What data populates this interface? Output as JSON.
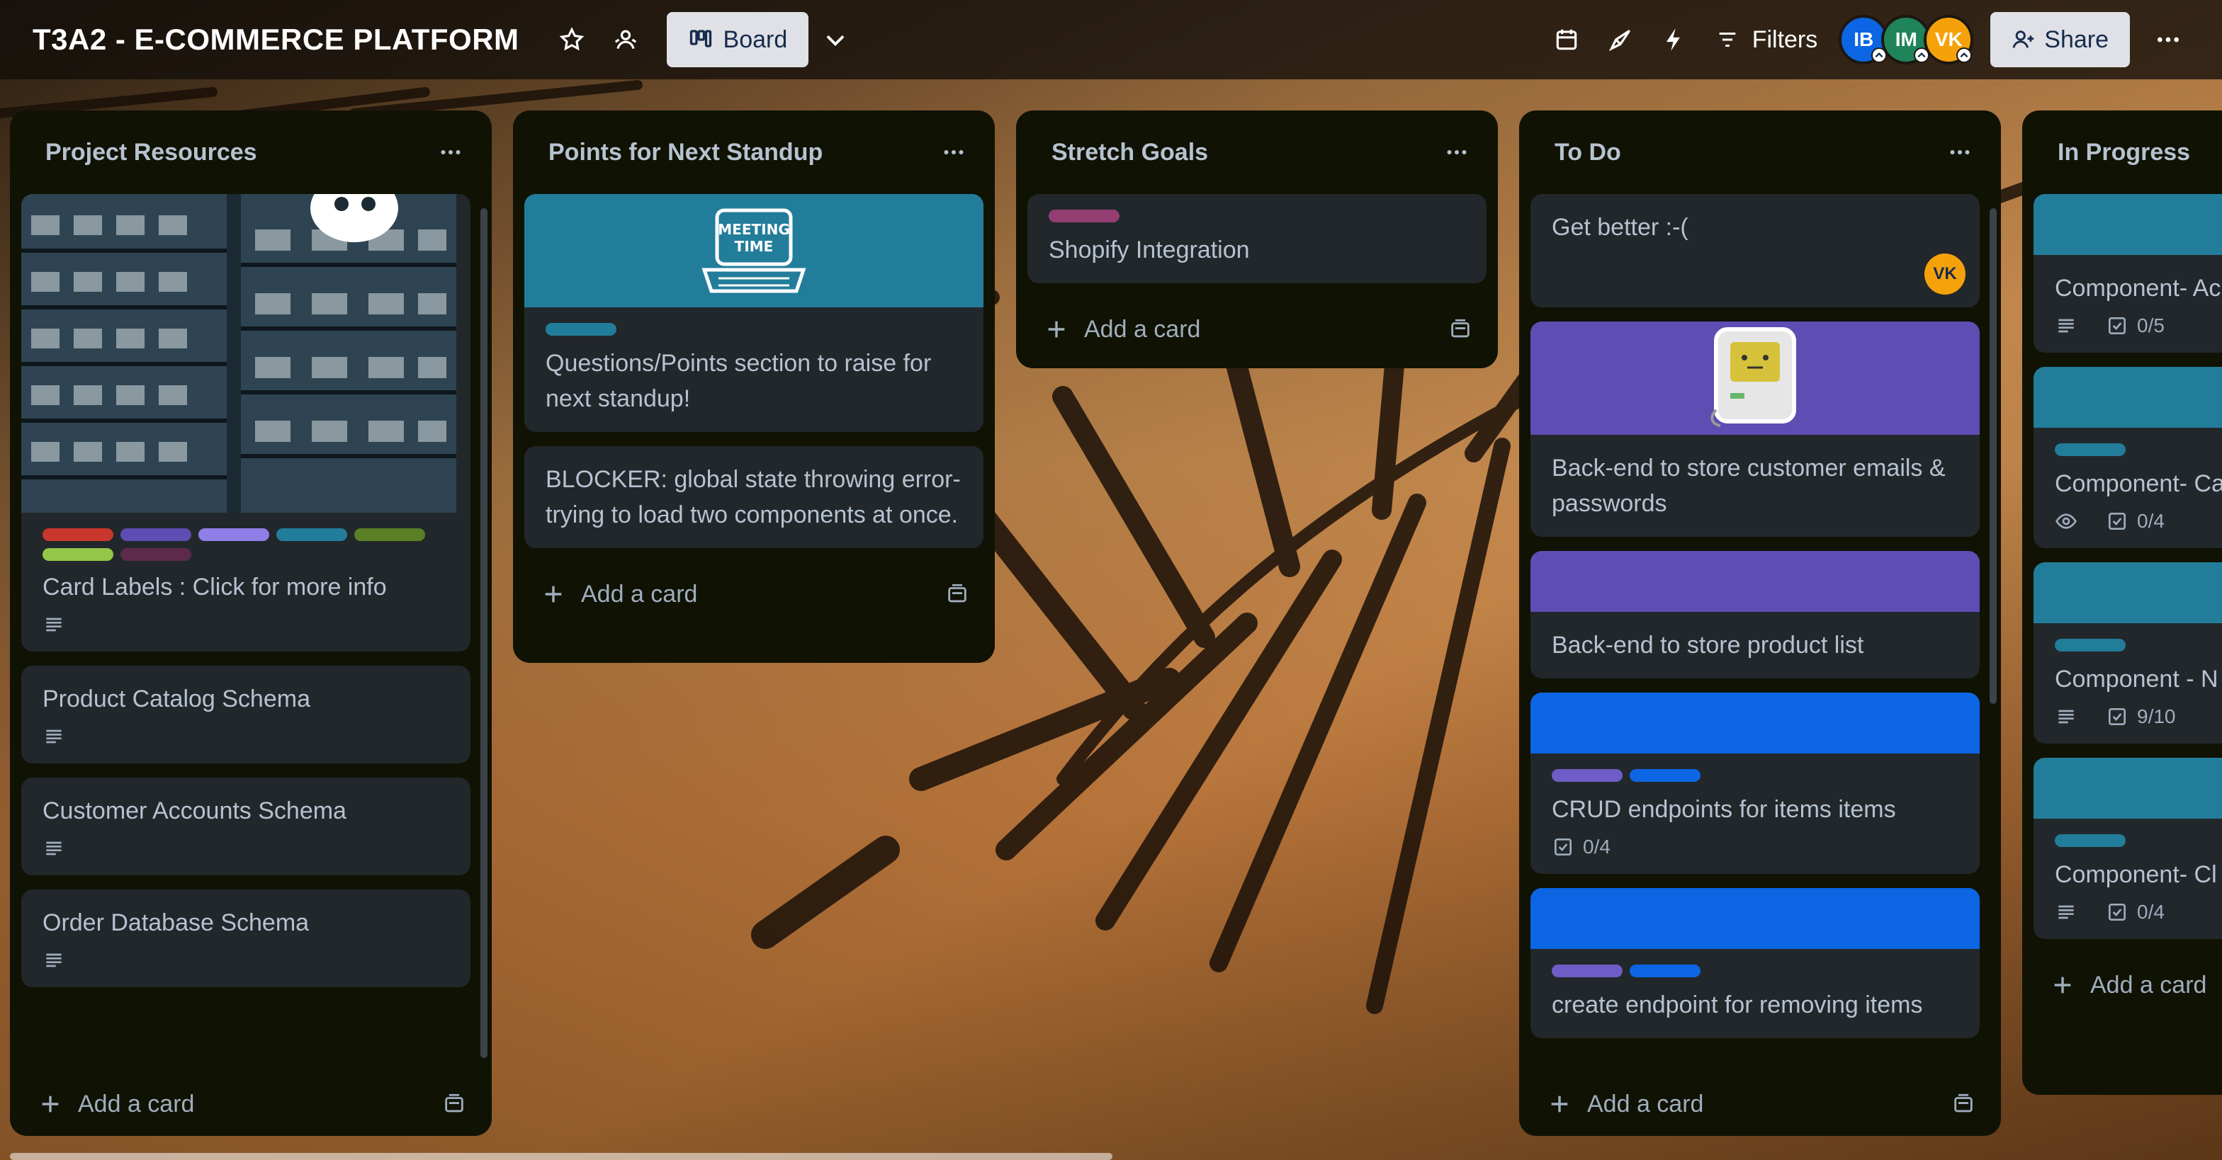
{
  "header": {
    "board_title": "T3A2 - E-COMMERCE PLATFORM",
    "view_label": "Board",
    "filters_label": "Filters",
    "share_label": "Share",
    "members": [
      {
        "initials": "IB",
        "color": "#0c66e4"
      },
      {
        "initials": "IM",
        "color": "#1f845a"
      },
      {
        "initials": "VK",
        "color": "#f5a20a"
      }
    ]
  },
  "lists": [
    {
      "title": "Project Resources",
      "add_label": "Add a card",
      "cards": [
        {
          "title": "Card Labels : Click for more info",
          "labels": [
            "#c9372c",
            "#5e4db2",
            "#8f7ee7",
            "#227d9b",
            "#5b7f24",
            "#94c748",
            "#5e2a4b"
          ],
          "has_description": true,
          "cover": "image"
        },
        {
          "title": "Product Catalog Schema",
          "has_description": true
        },
        {
          "title": "Customer Accounts Schema",
          "has_description": true
        },
        {
          "title": "Order Database Schema",
          "has_description": true
        }
      ]
    },
    {
      "title": "Points for Next Standup",
      "add_label": "Add a card",
      "cards": [
        {
          "title": "Questions/Points section to raise for next standup!",
          "labels": [
            "#227d9b"
          ],
          "cover_color": "#227d9b",
          "cover_text": "MEETING TIME"
        },
        {
          "title": "BLOCKER: global state throwing error- trying to load two components at once."
        }
      ]
    },
    {
      "title": "Stretch Goals",
      "add_label": "Add a card",
      "cards": [
        {
          "title": "Shopify Integration",
          "labels": [
            "#943d73"
          ]
        }
      ]
    },
    {
      "title": "To Do",
      "add_label": "Add a card",
      "cards": [
        {
          "title": "Get better :-(",
          "member": "VK"
        },
        {
          "title": "Back-end to store customer emails & passwords",
          "cover_color": "#5e4db2",
          "cover_image": "computer-sticker"
        },
        {
          "title": "Back-end to store product list",
          "cover_color": "#5e4db2"
        },
        {
          "title": "CRUD endpoints for items items",
          "cover_color": "#0c66e4",
          "labels": [
            "#6e5dc6",
            "#0c66e4"
          ],
          "checklist": "0/4"
        },
        {
          "title": "create endpoint for removing items",
          "cover_color": "#0c66e4",
          "labels": [
            "#6e5dc6",
            "#0c66e4"
          ]
        }
      ]
    },
    {
      "title": "In Progress",
      "add_label": "Add a card",
      "cards": [
        {
          "title": "Component- Ac",
          "cover_color": "#227d9b",
          "checklist": "0/5",
          "has_description": true
        },
        {
          "title": "Component- Ca",
          "cover_color": "#227d9b",
          "labels": [
            "#227d9b"
          ],
          "checklist": "0/4",
          "watching": true
        },
        {
          "title": "Component - N",
          "cover_color": "#227d9b",
          "labels": [
            "#227d9b"
          ],
          "checklist": "9/10",
          "has_description": true
        },
        {
          "title": "Component- Cl",
          "cover_color": "#227d9b",
          "labels": [
            "#227d9b"
          ],
          "checklist": "0/4",
          "has_description": true
        }
      ]
    }
  ]
}
